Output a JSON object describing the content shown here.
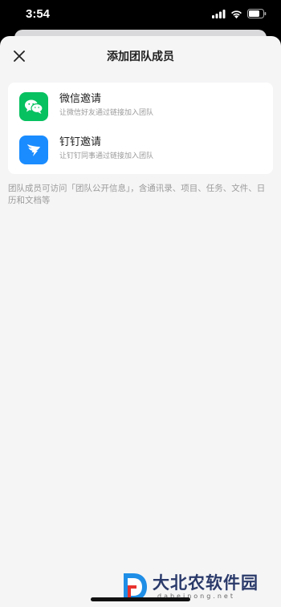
{
  "status_bar": {
    "time": "3:54"
  },
  "sheet": {
    "title": "添加团队成员",
    "options": [
      {
        "title": "微信邀请",
        "subtitle": "让微信好友通过链接加入团队",
        "icon": "wechat-icon",
        "color": "#07c160"
      },
      {
        "title": "钉钉邀请",
        "subtitle": "让钉钉同事通过链接加入团队",
        "icon": "dingtalk-icon",
        "color": "#1a8cff"
      }
    ],
    "note": "团队成员可访问「团队公开信息」，含通讯录、项目、任务、文件、日历和文档等"
  },
  "watermark": {
    "name": "大北农软件园",
    "url": "dabeinong.net"
  }
}
